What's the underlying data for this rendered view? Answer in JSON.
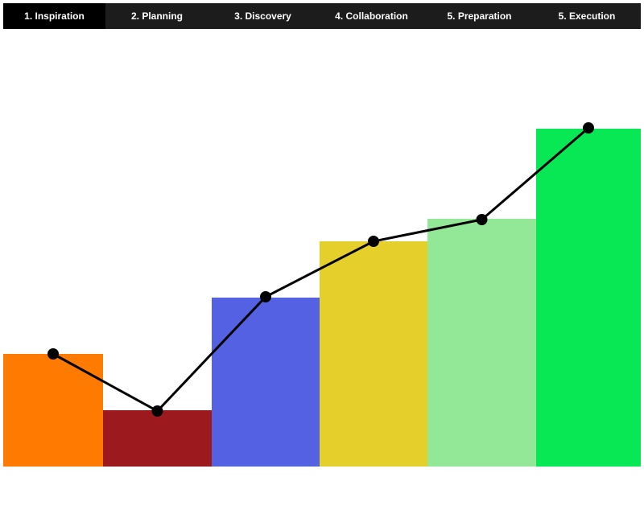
{
  "tabs": [
    {
      "label": "1. Inspiration",
      "active": true
    },
    {
      "label": "2. Planning",
      "active": false
    },
    {
      "label": "3. Discovery",
      "active": false
    },
    {
      "label": "4. Collaboration",
      "active": false
    },
    {
      "label": "5. Preparation",
      "active": false
    },
    {
      "label": "5. Execution",
      "active": false
    }
  ],
  "chart_data": {
    "type": "bar",
    "categories": [
      "1. Inspiration",
      "2. Planning",
      "3. Discovery",
      "4. Collaboration",
      "5. Preparation",
      "5. Execution"
    ],
    "values": [
      140,
      70,
      210,
      280,
      308,
      420
    ],
    "line_values": [
      140,
      69,
      211,
      280,
      307,
      421
    ],
    "colors": [
      "#ff7a00",
      "#9c1a1d",
      "#5561e3",
      "#e5cf2b",
      "#92e896",
      "#08e855"
    ],
    "line_color": "#000000",
    "ylim": [
      0,
      440
    ],
    "grid": false,
    "legend": "none",
    "axes_visible": false
  }
}
